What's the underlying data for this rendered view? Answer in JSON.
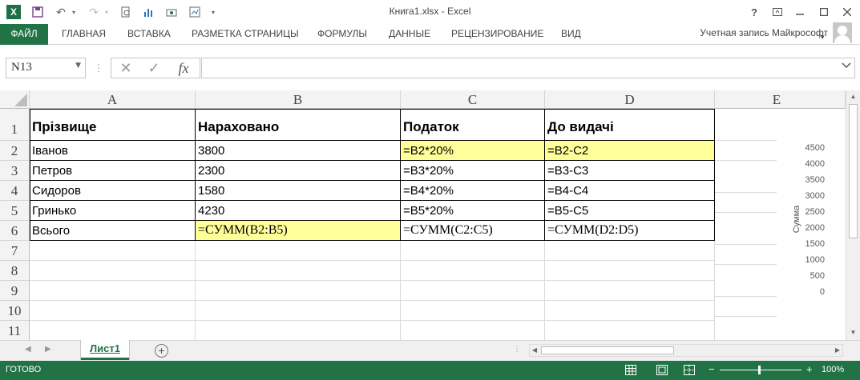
{
  "app": {
    "window_title": "Книга1.xlsx - Excel",
    "help": "?",
    "account": "Учетная запись Майкрософт"
  },
  "ribbon": {
    "tabs": [
      "ФАЙЛ",
      "ГЛАВНАЯ",
      "ВСТАВКА",
      "РАЗМЕТКА СТРАНИЦЫ",
      "ФОРМУЛЫ",
      "ДАННЫЕ",
      "РЕЦЕНЗИРОВАНИЕ",
      "ВИД"
    ]
  },
  "formula_bar": {
    "name_box": "N13",
    "fx_label": "fx",
    "formula": ""
  },
  "columns": [
    "A",
    "B",
    "C",
    "D",
    "E"
  ],
  "rows": [
    "1",
    "2",
    "3",
    "4",
    "5",
    "6",
    "7",
    "8",
    "9",
    "10",
    "11"
  ],
  "cells": {
    "A1": "Прізвище",
    "B1": "Нараховано",
    "C1": "Податок",
    "D1": "До видачі",
    "A2": "Іванов",
    "B2": "3800",
    "C2": "=B2*20%",
    "D2": "=B2-C2",
    "A3": "Петров",
    "B3": "2300",
    "C3": "=B3*20%",
    "D3": "=B3-C3",
    "A4": "Сидоров",
    "B4": "1580",
    "C4": "=B4*20%",
    "D4": "=B4-C4",
    "A5": "Гринько",
    "B5": "4230",
    "C5": "=B5*20%",
    "D5": "=B5-C5",
    "A6": "Всього",
    "B6": "=СУММ(B2:B5)",
    "C6": "=СУММ(C2:C5)",
    "D6": "=СУММ(D2:D5)"
  },
  "colors": {
    "excel_green": "#217346",
    "highlight_yellow": "#ffff99"
  },
  "chart_data": {
    "type": "bar",
    "ylabel": "Сумма",
    "yticks": [
      "4500",
      "4000",
      "3500",
      "3000",
      "2500",
      "2000",
      "1500",
      "1000",
      "500",
      "0"
    ],
    "ylim": [
      0,
      4500
    ]
  },
  "sheets": {
    "active": "Лист1"
  },
  "status": {
    "text": "ГОТОВО",
    "zoom": "100%"
  }
}
